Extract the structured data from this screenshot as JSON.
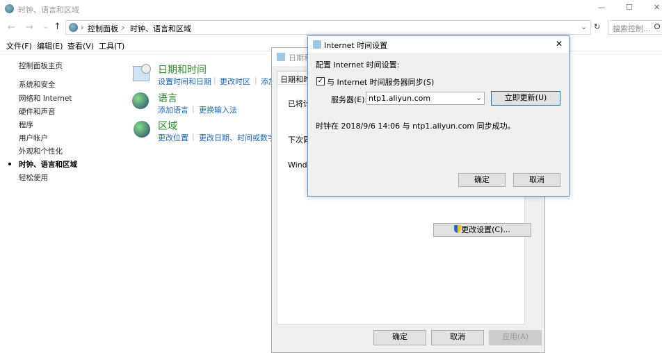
{
  "window": {
    "title": "时钟、语言和区域",
    "minimize": "—",
    "maximize": "☐",
    "close": "✕"
  },
  "nav": {
    "back": "←",
    "forward": "→",
    "recent": "⌄",
    "up": "↑",
    "breadcrumb": [
      "控制面板",
      "时钟、语言和区域"
    ],
    "refresh": "↻",
    "dropdown": "⌄",
    "search_placeholder": "搜索控制..."
  },
  "menu": [
    "文件(F)",
    "编辑(E)",
    "查看(V)",
    "工具(T)"
  ],
  "sidebar": {
    "home": "控制面板主页",
    "items": [
      "系统和安全",
      "网络和 Internet",
      "硬件和声音",
      "程序",
      "用户帐户",
      "外观和个性化",
      "时钟、语言和区域",
      "轻松使用"
    ],
    "active_index": 6
  },
  "categories": [
    {
      "title": "日期和时间",
      "icon": "clock-calendar-icon",
      "links": [
        "设置时间和日期",
        "更改时区",
        "添加"
      ]
    },
    {
      "title": "语言",
      "icon": "language-globe-icon",
      "links": [
        "添加语言",
        "更换输入法"
      ]
    },
    {
      "title": "区域",
      "icon": "region-globe-icon",
      "links": [
        "更改位置",
        "更改日期、时间或数字格式"
      ]
    }
  ],
  "back_dialog": {
    "title": "日期和",
    "tab": "日期和时",
    "lines": [
      "已将计",
      "下次同",
      "Windo"
    ],
    "change_settings": "更改设置(C)...",
    "ok": "确定",
    "cancel": "取消",
    "apply": "应用(A)"
  },
  "dialog": {
    "title": "Internet 时间设置",
    "close": "✕",
    "heading": "配置 Internet 时间设置:",
    "sync_label": "与 Internet 时间服务器同步(S)",
    "sync_checked": true,
    "server_label": "服务器(E):",
    "server_value": "ntp1.aliyun.com",
    "update_now": "立即更新(U)",
    "status": "时钟在 2018/9/6 14:06 与 ntp1.aliyun.com 同步成功。",
    "ok": "确定",
    "cancel": "取消"
  }
}
